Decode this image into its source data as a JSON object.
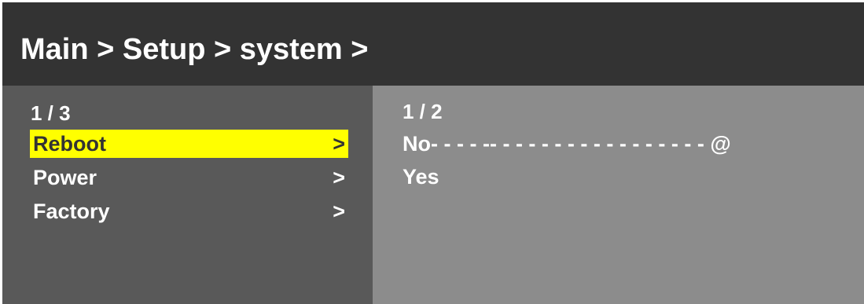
{
  "header": {
    "breadcrumb": "Main > Setup > system >"
  },
  "left_menu": {
    "page_indicator": "1 / 3",
    "items": [
      {
        "label": "Reboot",
        "arrow": ">",
        "selected": true
      },
      {
        "label": "Power",
        "arrow": ">",
        "selected": false
      },
      {
        "label": "Factory",
        "arrow": ">",
        "selected": false
      }
    ]
  },
  "right_menu": {
    "page_indicator": "1 / 2",
    "options": [
      {
        "text": "No- - - - -- - - - - - - - - - - - - - - - - @"
      },
      {
        "text": "Yes"
      }
    ]
  },
  "colors": {
    "header_bg": "#333333",
    "left_panel_bg": "#595959",
    "right_panel_bg": "#8c8c8c",
    "highlight": "#ffff00",
    "text": "#ffffff"
  }
}
